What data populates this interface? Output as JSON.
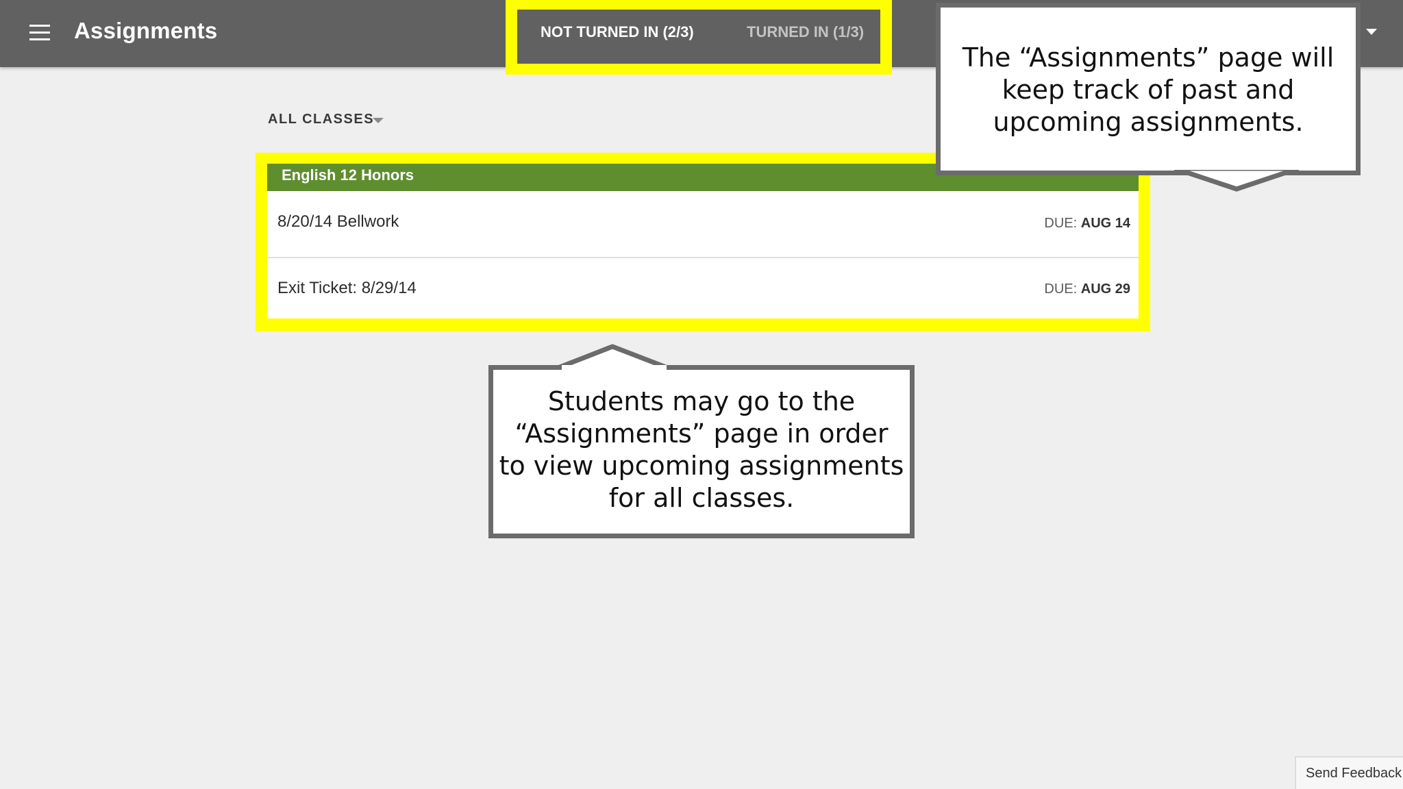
{
  "app_bar": {
    "title": "Assignments",
    "menu_icon": "hamburger-menu-icon",
    "account_icon": "account-dropdown-icon"
  },
  "tabs": [
    {
      "label": "NOT TURNED IN (2/3)",
      "active": true
    },
    {
      "label": "TURNED IN (1/3)",
      "active": false
    }
  ],
  "filter": {
    "label": "ALL CLASSES",
    "icon": "caret-down-icon"
  },
  "class_card": {
    "class_name": "English 12 Honors",
    "accent_color": "#5f8e2f",
    "due_prefix": "DUE:",
    "assignments": [
      {
        "title": "8/20/14 Bellwork",
        "due": "AUG 14"
      },
      {
        "title": "Exit Ticket: 8/29/14",
        "due": "AUG 29"
      }
    ]
  },
  "callouts": {
    "top": "The “Assignments” page will keep track of past and upcoming assignments.",
    "bottom": "Students may go to the “Assignments” page in order to view upcoming assignments for all classes."
  },
  "highlight_color": "#ffff00",
  "feedback": {
    "label": "Send Feedback"
  }
}
